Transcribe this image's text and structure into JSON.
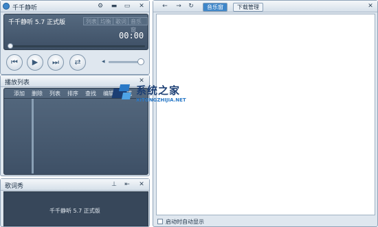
{
  "player": {
    "title": "千千静听",
    "song_name": "千千静听 5.7 正式版",
    "time": "00:00",
    "chips": [
      "列表",
      "均衡",
      "歌词",
      "音乐窗"
    ]
  },
  "playlist": {
    "title": "播放列表",
    "menu": [
      "添加",
      "删除",
      "列表",
      "排序",
      "查找",
      "编辑",
      "模式"
    ]
  },
  "lyrics": {
    "title": "歌词秀",
    "text": "千千静听 5.7 正式版"
  },
  "right": {
    "tabs": [
      "音乐窗",
      "下载管理"
    ],
    "startup_label": "启动时自动显示"
  },
  "watermark": {
    "main": "系统之家",
    "sub": "XITONGZHIJIA.NET"
  },
  "colors": {
    "accent": "#3e86c9"
  }
}
